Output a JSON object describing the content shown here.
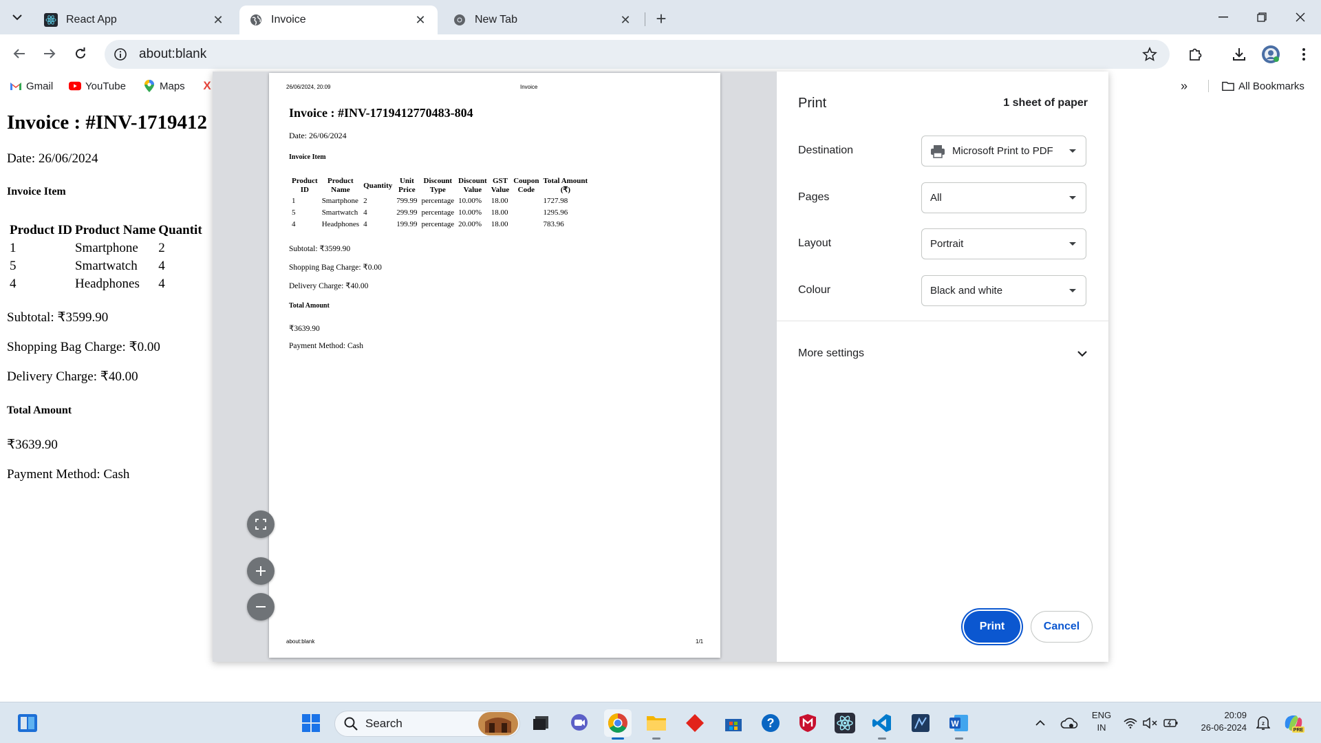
{
  "browser": {
    "tabs": [
      {
        "title": "React App",
        "icon": "react-icon"
      },
      {
        "title": "Invoice",
        "icon": "globe-icon",
        "active": true
      },
      {
        "title": "New Tab",
        "icon": "chrome-icon"
      }
    ],
    "url": "about:blank",
    "bookmarks": [
      {
        "label": "Gmail",
        "icon": "gmail-icon"
      },
      {
        "label": "YouTube",
        "icon": "youtube-icon"
      },
      {
        "label": "Maps",
        "icon": "maps-icon"
      },
      {
        "label": "",
        "icon": "x-icon"
      }
    ],
    "all_bookmarks": "All Bookmarks"
  },
  "page": {
    "title": "Invoice : #INV-1719412",
    "date": "Date: 26/06/2024",
    "items_heading": "Invoice Item",
    "columns": [
      "Product ID",
      "Product Name",
      "Quantit"
    ],
    "rows": [
      [
        "1",
        "Smartphone",
        "2"
      ],
      [
        "5",
        "Smartwatch",
        "4"
      ],
      [
        "4",
        "Headphones",
        "4"
      ]
    ],
    "subtotal": "Subtotal: ₹3599.90",
    "bag_charge": "Shopping Bag Charge: ₹0.00",
    "delivery_charge": "Delivery Charge: ₹40.00",
    "total_heading": "Total Amount",
    "total": "₹3639.90",
    "payment": "Payment Method: Cash"
  },
  "preview": {
    "header_date": "26/06/2024, 20:09",
    "header_title": "Invoice",
    "title": "Invoice : #INV-1719412770483-804",
    "date": "Date: 26/06/2024",
    "items_heading": "Invoice Item",
    "columns": [
      [
        "Product",
        "ID"
      ],
      [
        "Product",
        "Name"
      ],
      [
        "Quantity"
      ],
      [
        "Unit",
        "Price"
      ],
      [
        "Discount",
        "Type"
      ],
      [
        "Discount",
        "Value"
      ],
      [
        "GST",
        "Value"
      ],
      [
        "Coupon",
        "Code"
      ],
      [
        "Total Amount",
        "(₹)"
      ]
    ],
    "rows": [
      [
        "1",
        "Smartphone",
        "2",
        "799.99",
        "percentage",
        "10.00%",
        "18.00",
        "",
        "1727.98"
      ],
      [
        "5",
        "Smartwatch",
        "4",
        "299.99",
        "percentage",
        "10.00%",
        "18.00",
        "",
        "1295.96"
      ],
      [
        "4",
        "Headphones",
        "4",
        "199.99",
        "percentage",
        "20.00%",
        "18.00",
        "",
        "783.96"
      ]
    ],
    "subtotal": "Subtotal: ₹3599.90",
    "bag_charge": "Shopping Bag Charge: ₹0.00",
    "delivery_charge": "Delivery Charge: ₹40.00",
    "total_heading": "Total Amount",
    "total": "₹3639.90",
    "payment": "Payment Method: Cash",
    "footer_url": "about:blank",
    "footer_page": "1/1"
  },
  "print": {
    "title": "Print",
    "sheets": "1 sheet of paper",
    "destination_label": "Destination",
    "destination_value": "Microsoft Print to PDF",
    "pages_label": "Pages",
    "pages_value": "All",
    "layout_label": "Layout",
    "layout_value": "Portrait",
    "colour_label": "Colour",
    "colour_value": "Black and white",
    "more_settings": "More settings",
    "print_button": "Print",
    "cancel_button": "Cancel"
  },
  "taskbar": {
    "search_placeholder": "Search",
    "language_top": "ENG",
    "language_bottom": "IN",
    "time": "20:09",
    "date": "26-06-2024"
  },
  "colors": {
    "accent": "#0b57d0",
    "tabstrip": "#dfe6ee",
    "taskbar": "#dbe6f0"
  }
}
